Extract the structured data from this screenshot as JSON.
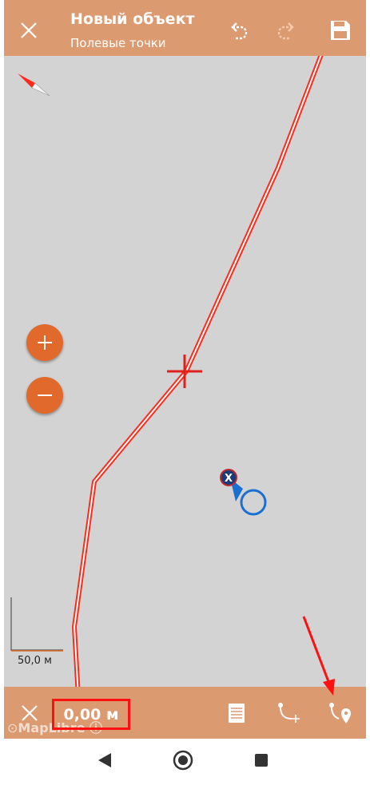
{
  "header": {
    "title": "Новый объект",
    "subtitle": "Полевые точки",
    "close_icon": "close-icon",
    "undo_icon": "undo-icon",
    "redo_icon": "redo-icon",
    "save_icon": "save-icon"
  },
  "map": {
    "zoom_in_icon": "plus-icon",
    "zoom_out_icon": "minus-icon",
    "scale_label": "50,0 м",
    "attribution": "MapLibre"
  },
  "bottom_bar": {
    "distance": "0,00 м",
    "cancel_icon": "close-icon",
    "list_icon": "list-icon",
    "add_vertex_icon": "add-vertex-icon",
    "add_point_icon": "add-point-icon"
  },
  "nav": {
    "back_icon": "back-triangle-icon",
    "home_icon": "home-circle-icon",
    "recents_icon": "recents-square-icon"
  },
  "colors": {
    "accent": "#dc9a71",
    "zoom_button": "#e0692b",
    "map_bg": "#d3d3d3",
    "track": "#ff2a1a",
    "location": "#1a6fd0",
    "annotation": "#ff1010"
  }
}
